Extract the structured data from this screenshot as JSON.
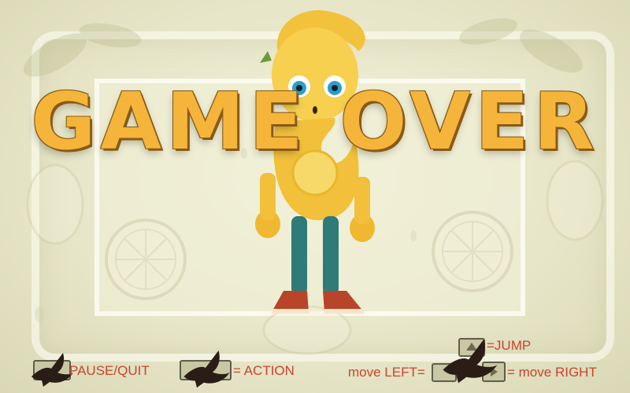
{
  "title": "GAME OVER",
  "controls": {
    "pause": "PAUSE/QUIT",
    "action": "= ACTION",
    "move_left": "move LEFT=",
    "jump": "=JUMP",
    "move_right": "= move RIGHT"
  },
  "icons": {
    "bird": "bird-silhouette-icon",
    "key": "keyboard-key-icon",
    "up_arrow": "up-arrow-key-icon",
    "right_arrow": "right-arrow-key-icon",
    "left_arrow": "left-arrow-key-icon"
  },
  "colors": {
    "title": "#f4b53a",
    "title_outline": "#8a5a14",
    "hud_text": "#c8442e",
    "background": "#e8e8cf"
  }
}
